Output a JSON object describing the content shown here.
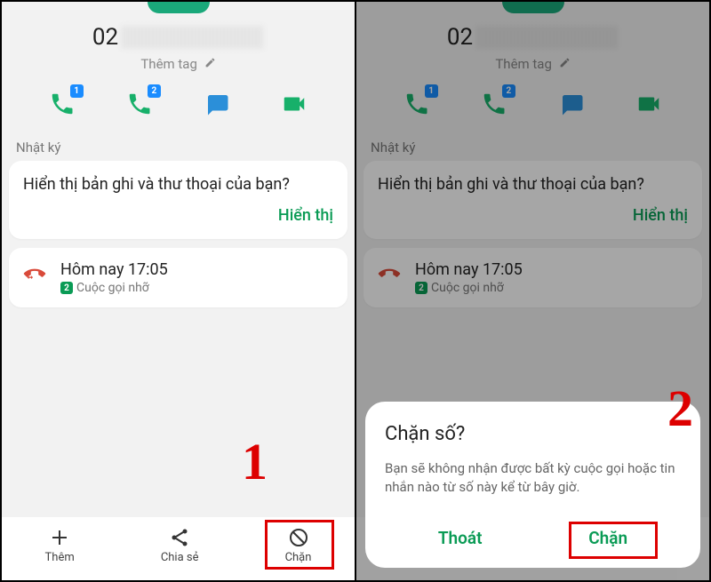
{
  "contact": {
    "phone_prefix": "02",
    "tag_label": "Thêm tag"
  },
  "action_badges": {
    "call1": "1",
    "call2": "2"
  },
  "sections": {
    "log_header": "Nhật ký"
  },
  "show_card": {
    "question": "Hiển thị bản ghi và thư thoại của bạn?",
    "action": "Hiển thị"
  },
  "log_entry": {
    "time_label": "Hôm nay 17:05",
    "sim_badge": "2",
    "sub_label": "Cuộc gọi nhỡ"
  },
  "bottom": {
    "more": "Thêm",
    "share": "Chia sẻ",
    "block": "Chặn"
  },
  "modal": {
    "title": "Chặn số?",
    "body": "Bạn sẽ không nhận được bất kỳ cuộc gọi hoặc tin nhắn nào từ số này kể từ bây giờ.",
    "cancel": "Thoát",
    "confirm": "Chặn"
  },
  "annotations": {
    "step1": "1",
    "step2": "2"
  }
}
